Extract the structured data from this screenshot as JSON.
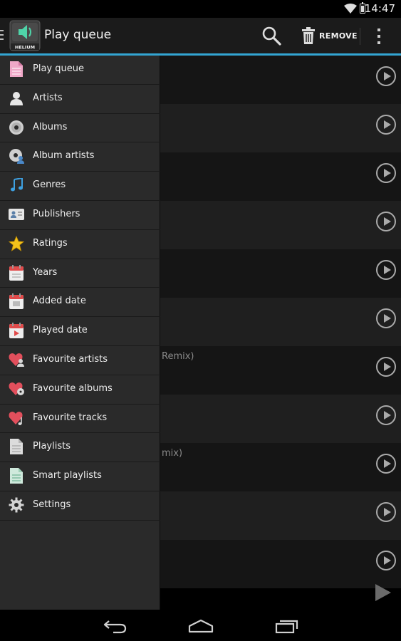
{
  "status_bar": {
    "time": "14:47"
  },
  "action_bar": {
    "title": "Play queue",
    "logo_text": "HELIUM",
    "remove_label": "REMOVE",
    "accent_color": "#33a5d2"
  },
  "drawer": {
    "items": [
      {
        "label": "Play queue",
        "icon": "document-pink-icon"
      },
      {
        "label": "Artists",
        "icon": "person-icon"
      },
      {
        "label": "Albums",
        "icon": "disc-icon"
      },
      {
        "label": "Album artists",
        "icon": "disc-person-icon"
      },
      {
        "label": "Genres",
        "icon": "music-note-icon"
      },
      {
        "label": "Publishers",
        "icon": "id-card-icon"
      },
      {
        "label": "Ratings",
        "icon": "star-icon"
      },
      {
        "label": "Years",
        "icon": "calendar-year-icon"
      },
      {
        "label": "Added date",
        "icon": "calendar-added-icon"
      },
      {
        "label": "Played date",
        "icon": "calendar-played-icon"
      },
      {
        "label": "Favourite artists",
        "icon": "heart-person-icon"
      },
      {
        "label": "Favourite albums",
        "icon": "heart-disc-icon"
      },
      {
        "label": "Favourite tracks",
        "icon": "heart-note-icon"
      },
      {
        "label": "Playlists",
        "icon": "playlist-document-icon"
      },
      {
        "label": "Smart playlists",
        "icon": "smart-playlist-document-icon"
      },
      {
        "label": "Settings",
        "icon": "gear-icon"
      }
    ]
  },
  "queue": {
    "visible_fragments": [
      {
        "row": 6,
        "text": "Remix)"
      },
      {
        "row": 8,
        "text": "mix)"
      }
    ]
  }
}
